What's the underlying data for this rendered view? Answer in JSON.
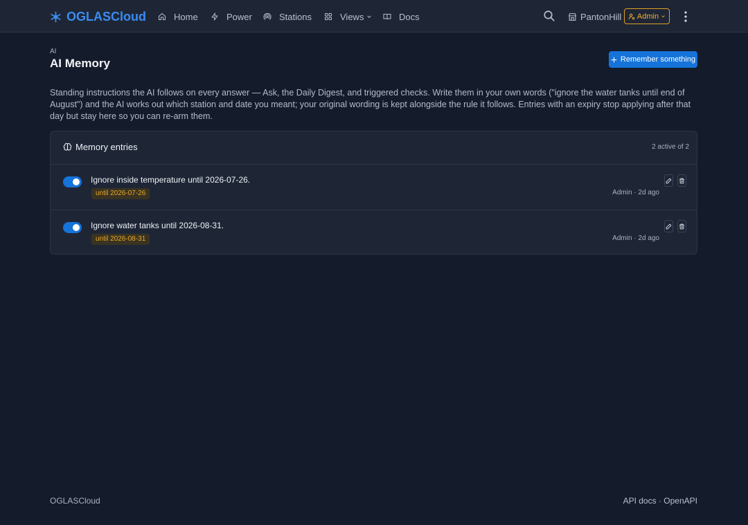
{
  "nav": {
    "brand": "OGLASCloud",
    "items": [
      {
        "label": "Home",
        "icon": "home-icon"
      },
      {
        "label": "Power",
        "icon": "bolt-icon"
      },
      {
        "label": "Stations",
        "icon": "broadcast-icon"
      },
      {
        "label": "Views",
        "icon": "grid-icon"
      },
      {
        "label": "Docs",
        "icon": "book-icon"
      }
    ],
    "station": "PantonHill",
    "admin": "Admin"
  },
  "header": {
    "eyebrow": "AI",
    "title": "AI Memory",
    "primary_action": "Remember something"
  },
  "description": "Standing instructions the AI follows on every answer — Ask, the Daily Digest, and triggered checks. Write them in your own words (\"ignore the water tanks until end of August\") and the AI works out which station and date you meant; your original wording is kept alongside the rule it follows. Entries with an expiry stop applying after that day but stay here so you can re-arm them.",
  "card": {
    "title": "Memory entries",
    "count": "2 active of 2",
    "entries": [
      {
        "text": "Ignore inside temperature until 2026-07-26.",
        "expiry": "until 2026-07-26",
        "meta": "Admin · 2d ago",
        "enabled": true
      },
      {
        "text": "Ignore water tanks until 2026-08-31.",
        "expiry": "until 2026-08-31",
        "meta": "Admin · 2d ago",
        "enabled": true
      }
    ]
  },
  "footer": {
    "left": "OGLASCloud",
    "api_docs": "API docs",
    "separator": "·",
    "openapi": "OpenAPI"
  },
  "colors": {
    "background": "#141b2b",
    "surface": "#1e2636",
    "accent": "#1573d9",
    "brand": "#3b8cf0",
    "warning": "#e9a82a"
  }
}
